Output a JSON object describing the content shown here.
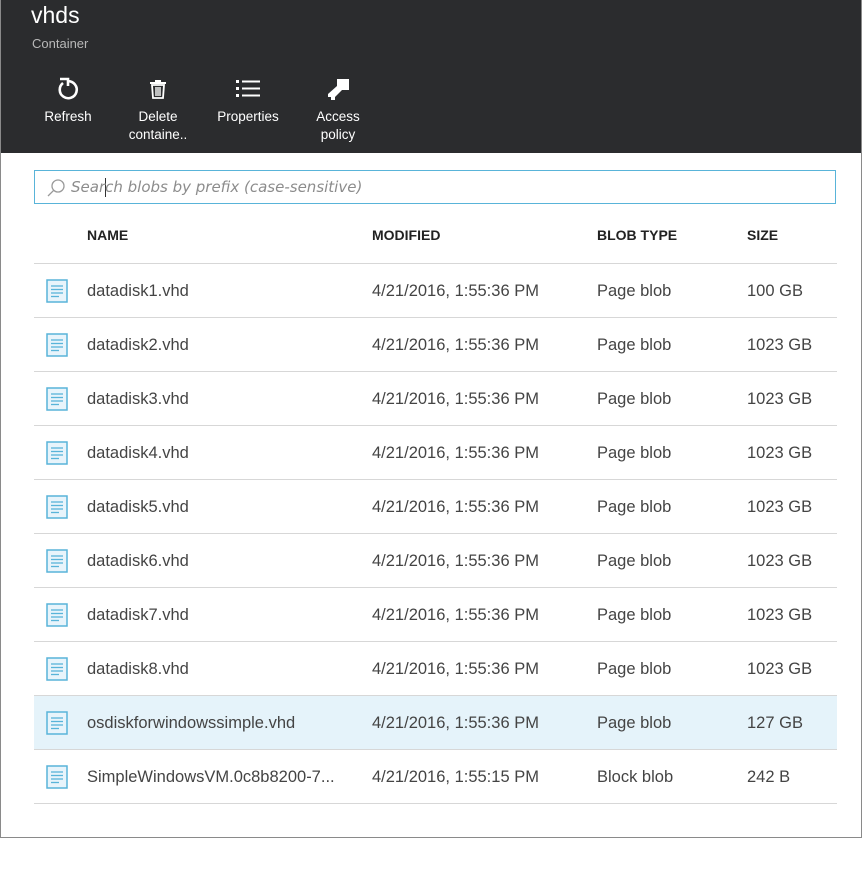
{
  "header": {
    "title": "vhds",
    "subtitle": "Container"
  },
  "commands": [
    {
      "label": "Refresh",
      "icon": "refresh-icon"
    },
    {
      "label": "Delete\ncontaine..",
      "icon": "trash-icon"
    },
    {
      "label": "Properties",
      "icon": "list-icon"
    },
    {
      "label": "Access\npolicy",
      "icon": "key-icon"
    }
  ],
  "search": {
    "placeholder": "Search blobs by prefix (case-sensitive)",
    "value": "",
    "icon": "search-icon"
  },
  "table": {
    "columns": [
      "NAME",
      "MODIFIED",
      "BLOB TYPE",
      "SIZE"
    ],
    "rows": [
      {
        "name": "datadisk1.vhd",
        "modified": "4/21/2016, 1:55:36 PM",
        "type": "Page blob",
        "size": "100 GB",
        "selected": false
      },
      {
        "name": "datadisk2.vhd",
        "modified": "4/21/2016, 1:55:36 PM",
        "type": "Page blob",
        "size": "1023 GB",
        "selected": false
      },
      {
        "name": "datadisk3.vhd",
        "modified": "4/21/2016, 1:55:36 PM",
        "type": "Page blob",
        "size": "1023 GB",
        "selected": false
      },
      {
        "name": "datadisk4.vhd",
        "modified": "4/21/2016, 1:55:36 PM",
        "type": "Page blob",
        "size": "1023 GB",
        "selected": false
      },
      {
        "name": "datadisk5.vhd",
        "modified": "4/21/2016, 1:55:36 PM",
        "type": "Page blob",
        "size": "1023 GB",
        "selected": false
      },
      {
        "name": "datadisk6.vhd",
        "modified": "4/21/2016, 1:55:36 PM",
        "type": "Page blob",
        "size": "1023 GB",
        "selected": false
      },
      {
        "name": "datadisk7.vhd",
        "modified": "4/21/2016, 1:55:36 PM",
        "type": "Page blob",
        "size": "1023 GB",
        "selected": false
      },
      {
        "name": "datadisk8.vhd",
        "modified": "4/21/2016, 1:55:36 PM",
        "type": "Page blob",
        "size": "1023 GB",
        "selected": false
      },
      {
        "name": "osdiskforwindowssimple.vhd",
        "modified": "4/21/2016, 1:55:36 PM",
        "type": "Page blob",
        "size": "127 GB",
        "selected": true
      },
      {
        "name": "SimpleWindowsVM.0c8b8200-7...",
        "modified": "4/21/2016, 1:55:15 PM",
        "type": "Block blob",
        "size": "242 B",
        "selected": false
      }
    ]
  },
  "colors": {
    "header_bg": "#2b2c2e",
    "search_border": "#59b4d9",
    "selected_row": "#e5f3fa",
    "file_icon": "#59b4d9"
  }
}
